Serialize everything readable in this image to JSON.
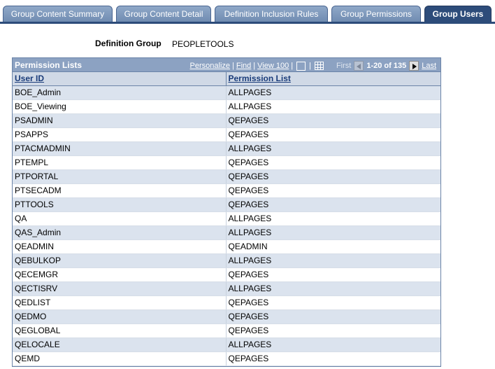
{
  "tabs": [
    {
      "label": "Group Content Summary",
      "active": false
    },
    {
      "label": "Group Content Detail",
      "active": false
    },
    {
      "label": "Definition Inclusion Rules",
      "active": false
    },
    {
      "label": "Group Permissions",
      "active": false
    },
    {
      "label": "Group Users",
      "active": true
    }
  ],
  "definition_group": {
    "label": "Definition Group",
    "value": "PEOPLETOOLS"
  },
  "grid": {
    "title": "Permission Lists",
    "personalize": "Personalize",
    "find": "Find",
    "view": "View 100",
    "first": "First",
    "range": "1-20 of 135",
    "last": "Last",
    "columns": [
      "User ID",
      "Permission List"
    ],
    "rows": [
      [
        "BOE_Admin",
        "ALLPAGES"
      ],
      [
        "BOE_Viewing",
        "ALLPAGES"
      ],
      [
        "PSADMIN",
        "QEPAGES"
      ],
      [
        "PSAPPS",
        "QEPAGES"
      ],
      [
        "PTACMADMIN",
        "ALLPAGES"
      ],
      [
        "PTEMPL",
        "QEPAGES"
      ],
      [
        "PTPORTAL",
        "QEPAGES"
      ],
      [
        "PTSECADM",
        "QEPAGES"
      ],
      [
        "PTTOOLS",
        "QEPAGES"
      ],
      [
        "QA",
        "ALLPAGES"
      ],
      [
        "QAS_Admin",
        "ALLPAGES"
      ],
      [
        "QEADMIN",
        "QEADMIN"
      ],
      [
        "QEBULKOP",
        "ALLPAGES"
      ],
      [
        "QECEMGR",
        "QEPAGES"
      ],
      [
        "QECTISRV",
        "ALLPAGES"
      ],
      [
        "QEDLIST",
        "QEPAGES"
      ],
      [
        "QEDMO",
        "QEPAGES"
      ],
      [
        "QEGLOBAL",
        "QEPAGES"
      ],
      [
        "QELOCALE",
        "ALLPAGES"
      ],
      [
        "QEMD",
        "QEPAGES"
      ]
    ]
  }
}
